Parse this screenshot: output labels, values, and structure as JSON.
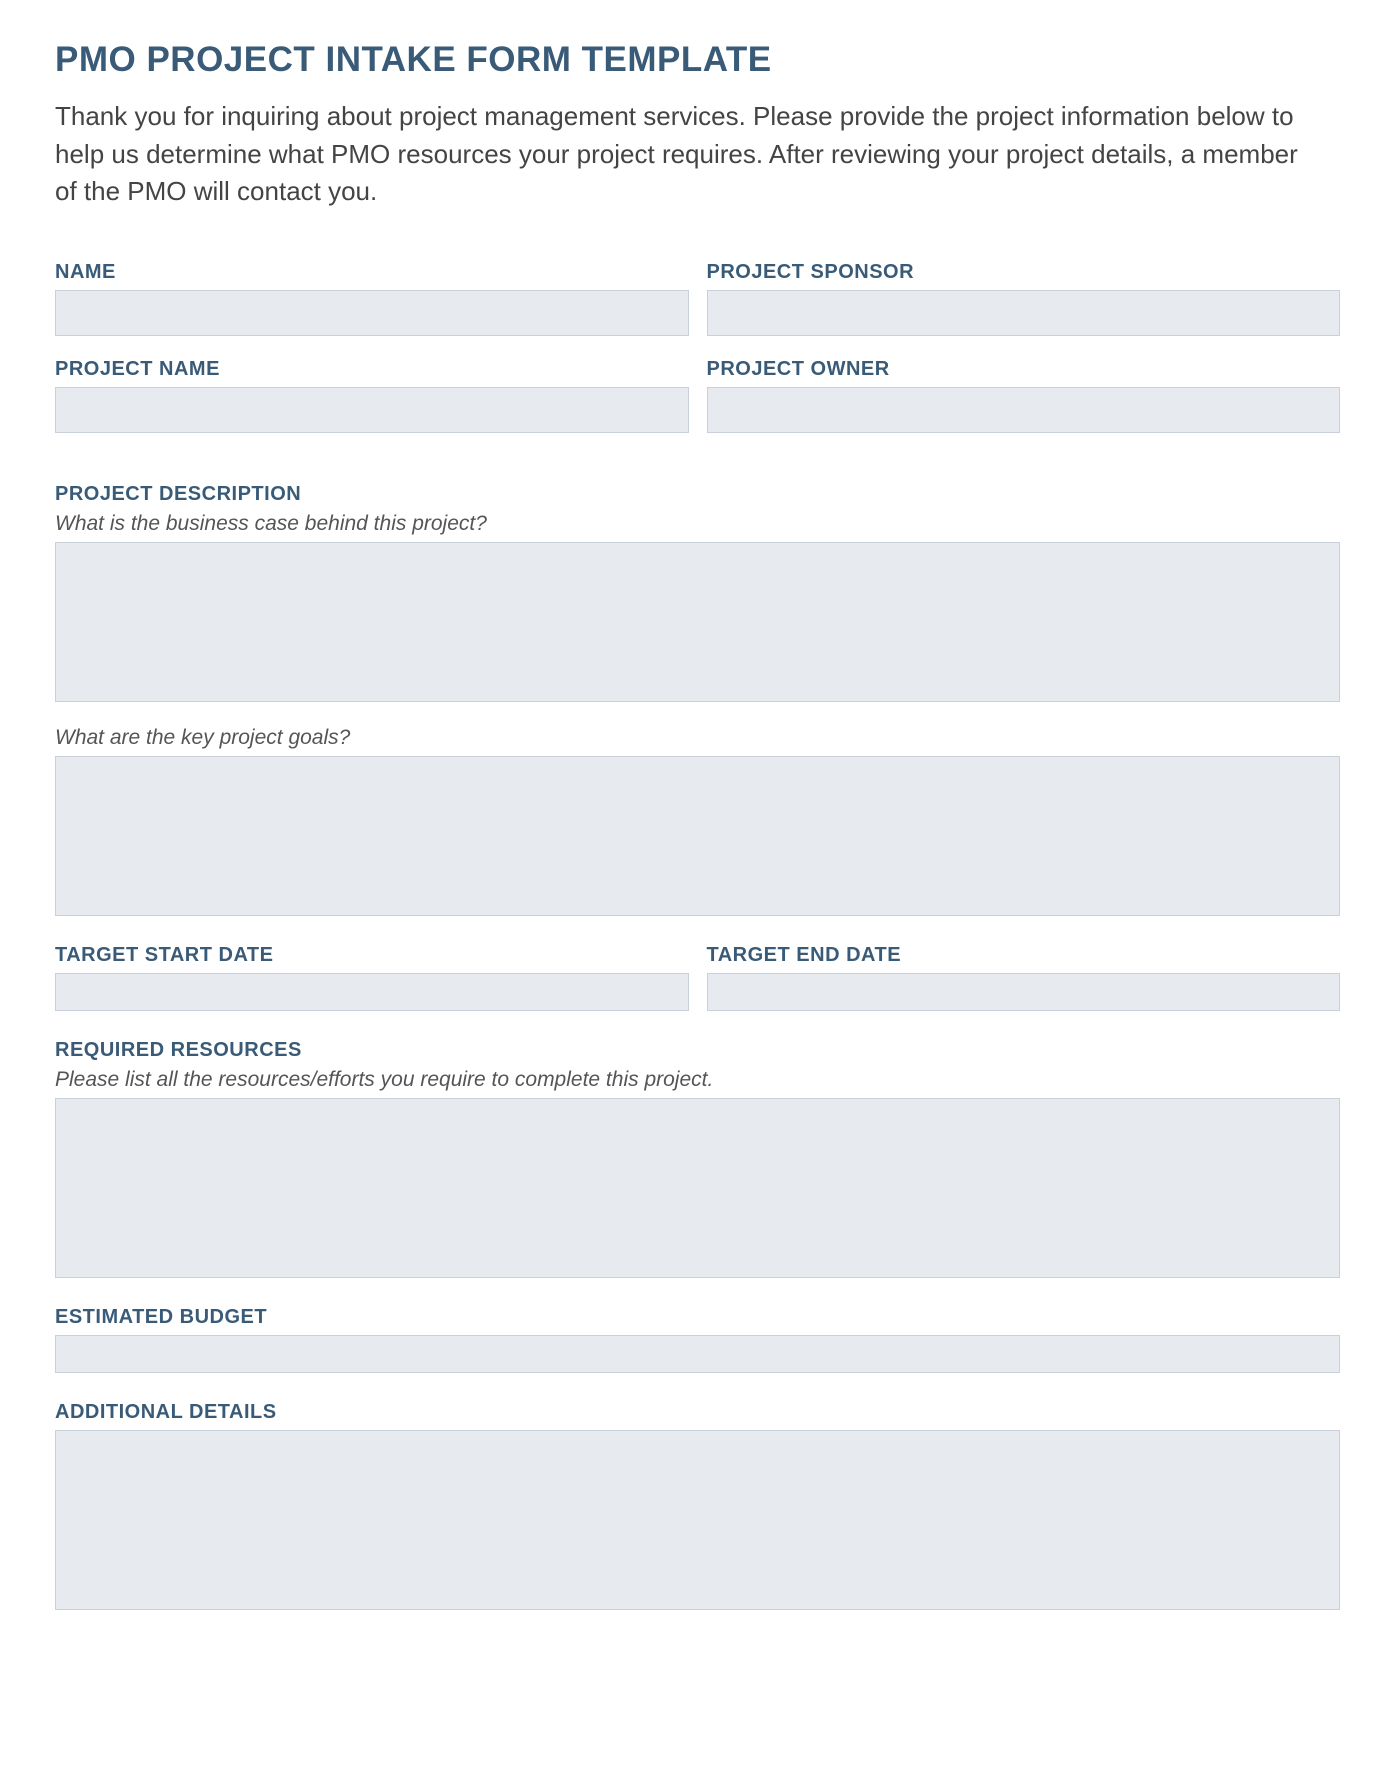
{
  "title": "PMO PROJECT INTAKE FORM TEMPLATE",
  "intro": "Thank you for inquiring about project management services. Please provide the project information below to help us determine what PMO resources your project requires. After reviewing your project details, a member of the PMO will contact you.",
  "fields": {
    "name": {
      "label": "NAME",
      "value": ""
    },
    "project_sponsor": {
      "label": "PROJECT SPONSOR",
      "value": ""
    },
    "project_name": {
      "label": "PROJECT NAME",
      "value": ""
    },
    "project_owner": {
      "label": "PROJECT OWNER",
      "value": ""
    },
    "project_description": {
      "label": "PROJECT DESCRIPTION",
      "business_case": {
        "prompt": "What is the business case behind this project?",
        "value": ""
      },
      "key_goals": {
        "prompt": "What are the key project goals?",
        "value": ""
      }
    },
    "target_start_date": {
      "label": "TARGET START DATE",
      "value": ""
    },
    "target_end_date": {
      "label": "TARGET END DATE",
      "value": ""
    },
    "required_resources": {
      "label": "REQUIRED RESOURCES",
      "prompt": "Please list all the resources/efforts you require to complete this project.",
      "value": ""
    },
    "estimated_budget": {
      "label": "ESTIMATED BUDGET",
      "value": ""
    },
    "additional_details": {
      "label": "ADDITIONAL DETAILS",
      "value": ""
    }
  }
}
